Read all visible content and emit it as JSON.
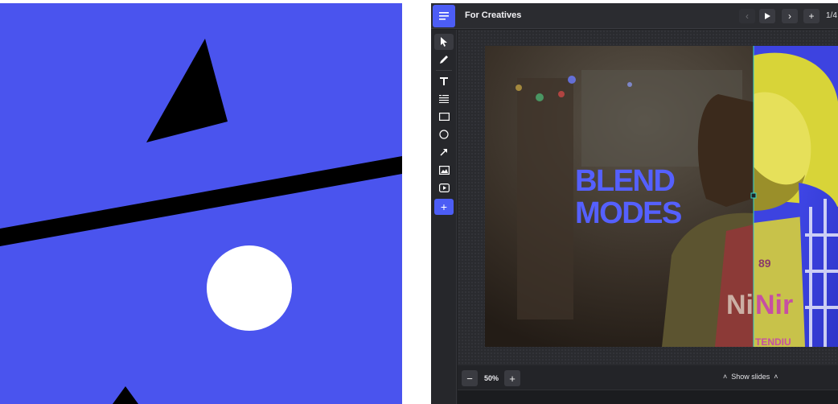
{
  "editor": {
    "document_title": "For Creatives",
    "page_indicator": "1/4",
    "zoom_level": "50%",
    "show_slides_label": "Show slides",
    "accent_color": "#4c5df5"
  },
  "toolbar_icons": [
    "select-arrow-icon",
    "pen-icon",
    "text-icon",
    "text-list-icon",
    "rectangle-icon",
    "ellipse-icon",
    "arrow-icon",
    "image-icon",
    "video-icon",
    "add-icon"
  ],
  "slide": {
    "headline_line1": "BLEND",
    "headline_line2": "MODES",
    "shirt_number": "89",
    "shirt_text": "Nir",
    "shirt_subtext": "TENDIU"
  },
  "art_panel": {
    "background_color": "#4a54ee"
  }
}
